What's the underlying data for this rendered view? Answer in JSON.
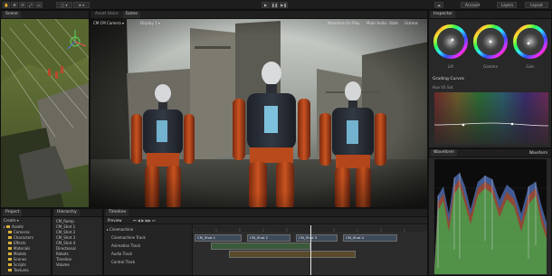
{
  "toolbar": {
    "layers_label": "Layers",
    "layout_label": "Layout",
    "account_label": "Account"
  },
  "scene": {
    "tab_label": "Scene"
  },
  "game": {
    "tab_assets": "Asset Store",
    "tab_game": "Game",
    "camera_select": "CM CM Camera",
    "display": "Display 1",
    "maximize": "Maximize On Play",
    "mute": "Mute Audio",
    "stats": "Stats",
    "gizmos": "Gizmos"
  },
  "inspector": {
    "tab_label": "Inspector",
    "wheels": [
      {
        "label": "Lift",
        "color": "#e0d040"
      },
      {
        "label": "Gamma",
        "color": "#40d0c0"
      },
      {
        "label": "Gain",
        "color": "#d04040"
      }
    ],
    "curves_title": "Grading Curves",
    "curve_channel": "Hue VS Sat"
  },
  "waveform": {
    "tab_label": "Waveform",
    "title": "Waveform"
  },
  "project": {
    "tab_label": "Project",
    "create_label": "Create",
    "items": [
      "Assets",
      "Cameras",
      "Characters",
      "Effects",
      "Materials",
      "Models",
      "Scenes",
      "Scripts",
      "Textures"
    ]
  },
  "hierarchy": {
    "tab_label": "Hierarchy",
    "items": [
      "CM_Ramp",
      "CM_Shot 1",
      "CM_Shot 2",
      "CM_Shot 3",
      "CM_Shot 4",
      "Directional",
      "Robots",
      "Timeline",
      "Volume"
    ]
  },
  "timeline": {
    "tab_label": "Timeline",
    "preview_label": "Preview",
    "track_group": "Cinemachine",
    "tracks": [
      "Cinemachine Track",
      "Animation Track",
      "Audio Track",
      "Control Track"
    ],
    "clips": [
      "CM_Shot 1",
      "CM_Shot 2",
      "CM_Shot 3",
      "CM_Shot 4"
    ]
  }
}
